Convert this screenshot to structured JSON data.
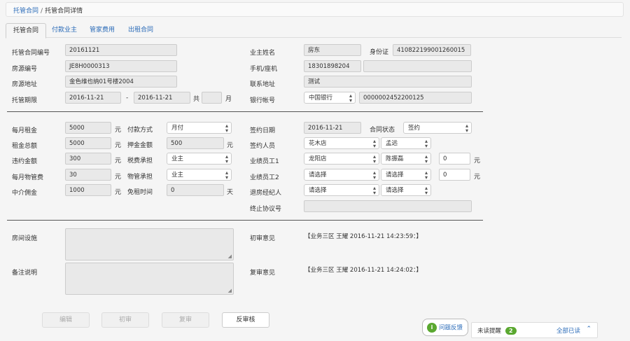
{
  "breadcrumb": {
    "parent": "托管合同",
    "separator": "/",
    "current": "托管合同详情"
  },
  "tabs": [
    "托管合同",
    "付款业主",
    "管家费用",
    "出租合同"
  ],
  "contract": {
    "id_label": "托管合同编号",
    "id_value": "20161121",
    "house_label": "房源编号",
    "house_value": "JE8H0000313",
    "address_label": "房源地址",
    "address_value": "金色维也纳01号楼2004",
    "period_label": "托管期限",
    "period_start": "2016-11-21",
    "period_dash": "-",
    "period_end": "2016-11-21",
    "total_label": "共",
    "months_value": "",
    "month_unit": "月",
    "owner_label": "业主姓名",
    "owner_value": "房东",
    "idcard_label": "身份证",
    "idcard_value": "410822199001260015",
    "phone_label": "手机/座机",
    "phone_value": "18301898204",
    "landline_value": "",
    "contact_label": "联系地址",
    "contact_value": "测试",
    "bank_label": "银行帐号",
    "bank_name": "中国银行",
    "bank_account": "0000002452200125"
  },
  "payment": {
    "rent_label": "每月租金",
    "rent_value": "5000",
    "rent_unit": "元",
    "paytype_label": "付款方式",
    "paytype_value": "月付",
    "total_label": "租金总额",
    "total_value": "5000",
    "total_unit": "元",
    "deposit_label": "押金金额",
    "deposit_value": "500",
    "deposit_unit": "元",
    "penalty_label": "违约金额",
    "penalty_value": "300",
    "penalty_unit": "元",
    "tax_label": "税费承担",
    "tax_value": "业主",
    "mgmt_label": "每月物管费",
    "mgmt_value": "30",
    "mgmt_unit": "元",
    "property_label": "物管承担",
    "property_value": "业主",
    "agent_label": "中介佣金",
    "agent_value": "1000",
    "agent_unit": "元",
    "freerent_label": "免租时间",
    "freerent_value": "0",
    "freerent_unit": "天",
    "sign_date_label": "签约日期",
    "sign_date_value": "2016-11-21",
    "status_label": "合同状态",
    "status_value": "签约",
    "signer_label": "签约人员",
    "signer_store": "花木店",
    "signer_person": "孟远",
    "emp1_label": "业绩员工1",
    "emp1_store": "龙阳店",
    "emp1_person": "陈振磊",
    "emp1_amount": "0",
    "emp1_unit": "元",
    "emp2_label": "业绩员工2",
    "emp2_store": "请选择",
    "emp2_person": "请选择",
    "emp2_amount": "0",
    "emp2_unit": "元",
    "checkout_label": "退房经纪人",
    "checkout_store": "请选择",
    "checkout_person": "请选择",
    "terminate_label": "终止协议号",
    "terminate_value": ""
  },
  "notes": {
    "facilities_label": "房间设施",
    "remarks_label": "备注说明",
    "first_review_label": "初审意见",
    "first_review_value": "【业务三区 王耀 2016-11-21 14:23:59：】",
    "second_review_label": "复审意见",
    "second_review_value": "【业务三区 王耀 2016-11-21 14:24:02：】"
  },
  "actions": {
    "edit": "编辑",
    "first_review": "初审",
    "second_review": "复审",
    "reverse_review": "反审核"
  },
  "footer": {
    "feedback": "问题反馈",
    "unread_label": "未读提醒",
    "unread_count": "2",
    "mark_all_read": "全部已读"
  }
}
